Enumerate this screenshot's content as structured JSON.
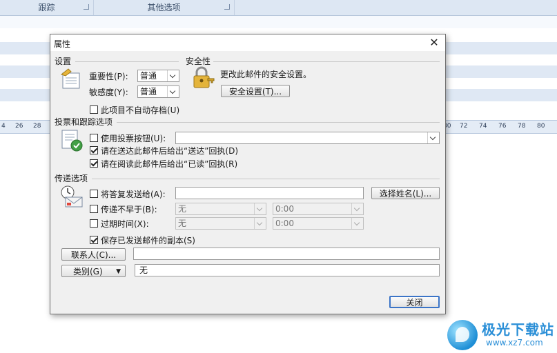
{
  "background": {
    "ribbon_groups": [
      "跟踪",
      "其他选项"
    ],
    "ruler_ticks_left": [
      "4",
      "26",
      "28"
    ],
    "ruler_ticks_right": [
      "80",
      "72",
      "74",
      "76",
      "78",
      "80"
    ]
  },
  "dialog": {
    "title": "属性",
    "settings": {
      "heading": "设置",
      "importance_label": "重要性(P):",
      "importance_value": "普通",
      "sensitivity_label": "敏感度(Y):",
      "sensitivity_value": "普通",
      "no_autoarchive_label": "此项目不自动存档(U)",
      "no_autoarchive_checked": false
    },
    "security": {
      "heading": "安全性",
      "description": "更改此邮件的安全设置。",
      "button": "安全设置(T)..."
    },
    "voting": {
      "heading": "投票和跟踪选项",
      "use_voting_label": "使用投票按钮(U):",
      "use_voting_checked": false,
      "voting_value": "",
      "delivery_receipt_label": "请在送达此邮件后给出“送达”回执(D)",
      "delivery_receipt_checked": true,
      "read_receipt_label": "请在阅读此邮件后给出“已读”回执(R)",
      "read_receipt_checked": true
    },
    "delivery": {
      "heading": "传递选项",
      "reply_to_label": "将答复发送给(A):",
      "reply_to_checked": false,
      "reply_to_value": "",
      "select_names_button": "选择姓名(L)...",
      "not_before_label": "传递不早于(B):",
      "not_before_checked": false,
      "not_before_date": "无",
      "not_before_time": "0:00",
      "expires_label": "过期时间(X):",
      "expires_checked": false,
      "expires_date": "无",
      "expires_time": "0:00",
      "save_copy_label": "保存已发送邮件的副本(S)",
      "save_copy_checked": true
    },
    "contacts_button": "联系人(C)...",
    "contacts_value": "",
    "categories_button": "类别(G)",
    "categories_value": "无",
    "close_button": "关闭"
  },
  "watermark": {
    "title": "极光下载站",
    "url": "www.xz7.com"
  },
  "colors": {
    "ribbon": "#dde7f3",
    "dialog_bg": "#f0f0f0",
    "default_button_border": "#3b74c7"
  }
}
